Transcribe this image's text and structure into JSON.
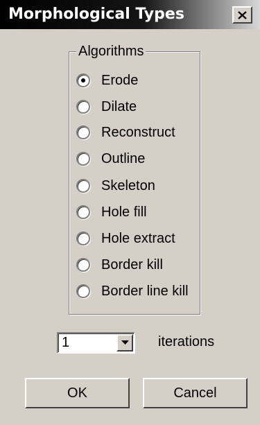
{
  "window": {
    "title": "Morphological Types",
    "close_icon": "close-icon"
  },
  "algorithms": {
    "label": "Algorithms",
    "selected_index": 0,
    "options": [
      "Erode",
      "Dilate",
      "Reconstruct",
      "Outline",
      "Skeleton",
      "Hole fill",
      "Hole extract",
      "Border kill",
      "Border line kill"
    ]
  },
  "iterations": {
    "value": "1",
    "label": "iterations",
    "dropdown_icon": "chevron-down-icon"
  },
  "buttons": {
    "ok": "OK",
    "cancel": "Cancel"
  }
}
